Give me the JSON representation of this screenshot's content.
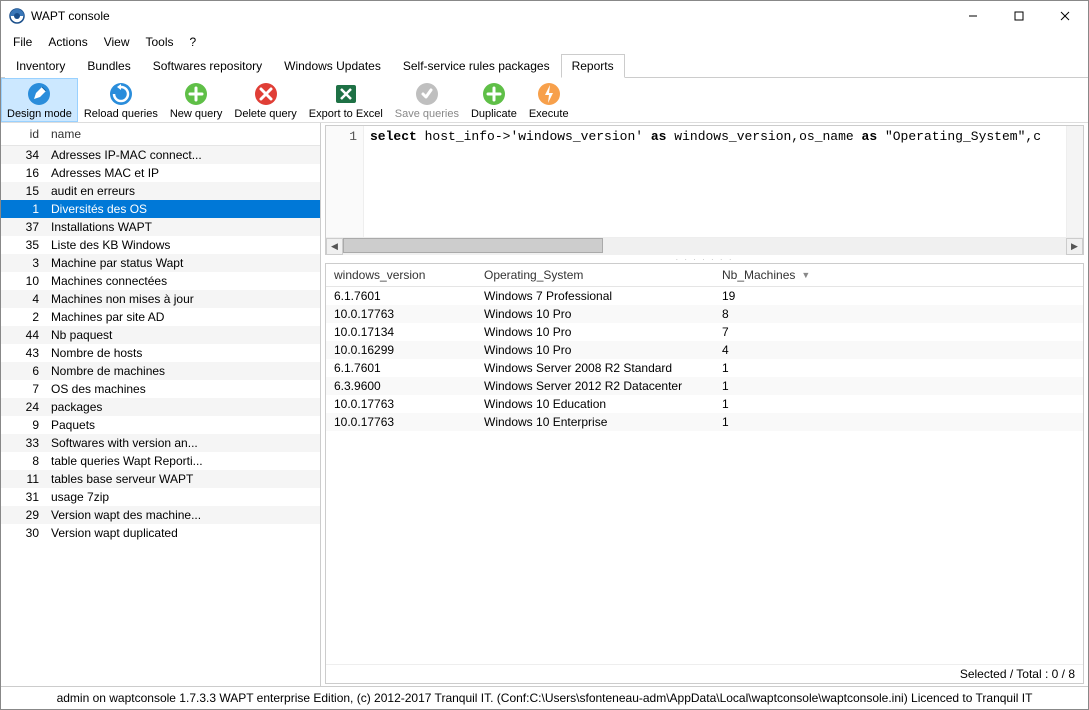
{
  "window": {
    "title": "WAPT console"
  },
  "menu": {
    "items": [
      "File",
      "Actions",
      "View",
      "Tools",
      "?"
    ]
  },
  "tabs": {
    "items": [
      "Inventory",
      "Bundles",
      "Softwares repository",
      "Windows Updates",
      "Self-service rules packages",
      "Reports"
    ],
    "active_index": 5
  },
  "toolbar": {
    "design_mode": "Design mode",
    "reload": "Reload queries",
    "new": "New query",
    "delete": "Delete query",
    "export": "Export to Excel",
    "save": "Save queries",
    "duplicate": "Duplicate",
    "execute": "Execute"
  },
  "queries": {
    "header_id": "id",
    "header_name": "name",
    "selected_id": 1,
    "rows": [
      {
        "id": 34,
        "name": "Adresses IP-MAC connect..."
      },
      {
        "id": 16,
        "name": "Adresses MAC et IP"
      },
      {
        "id": 15,
        "name": "audit en erreurs"
      },
      {
        "id": 1,
        "name": "Diversités des OS"
      },
      {
        "id": 37,
        "name": "Installations WAPT"
      },
      {
        "id": 35,
        "name": "Liste des KB Windows"
      },
      {
        "id": 3,
        "name": "Machine par status Wapt"
      },
      {
        "id": 10,
        "name": "Machines connectées"
      },
      {
        "id": 4,
        "name": "Machines non mises à jour"
      },
      {
        "id": 2,
        "name": "Machines par site AD"
      },
      {
        "id": 44,
        "name": "Nb paquest"
      },
      {
        "id": 43,
        "name": "Nombre de hosts"
      },
      {
        "id": 6,
        "name": "Nombre de machines"
      },
      {
        "id": 7,
        "name": "OS des machines"
      },
      {
        "id": 24,
        "name": "packages"
      },
      {
        "id": 9,
        "name": "Paquets"
      },
      {
        "id": 33,
        "name": "Softwares with version an..."
      },
      {
        "id": 8,
        "name": "table queries Wapt Reporti..."
      },
      {
        "id": 11,
        "name": "tables base serveur WAPT"
      },
      {
        "id": 31,
        "name": "usage 7zip"
      },
      {
        "id": 29,
        "name": "Version wapt des machine..."
      },
      {
        "id": 30,
        "name": "Version wapt duplicated"
      }
    ]
  },
  "sql": {
    "line_no": "1",
    "tokens": {
      "t1": "select",
      "t2": " host_info->",
      "t3": "'windows_version'",
      "t4": " ",
      "t5": "as",
      "t6": " windows_version,os_name ",
      "t7": "as",
      "t8": " ",
      "t9": "\"Operating_System\"",
      "t10": ",c"
    }
  },
  "results": {
    "columns": {
      "c1": "windows_version",
      "c2": "Operating_System",
      "c3": "Nb_Machines"
    },
    "rows": [
      {
        "v": "6.1.7601",
        "os": "Windows 7 Professional",
        "n": "19"
      },
      {
        "v": "10.0.17763",
        "os": "Windows 10 Pro",
        "n": "8"
      },
      {
        "v": "10.0.17134",
        "os": "Windows 10 Pro",
        "n": "7"
      },
      {
        "v": "10.0.16299",
        "os": "Windows 10 Pro",
        "n": "4"
      },
      {
        "v": "6.1.7601",
        "os": "Windows Server 2008 R2 Standard",
        "n": "1"
      },
      {
        "v": "6.3.9600",
        "os": "Windows Server 2012 R2 Datacenter",
        "n": "1"
      },
      {
        "v": "10.0.17763",
        "os": "Windows 10 Education",
        "n": "1"
      },
      {
        "v": "10.0.17763",
        "os": "Windows 10 Enterprise",
        "n": "1"
      }
    ],
    "footer": "Selected / Total : 0 / 8"
  },
  "status": "admin on waptconsole 1.7.3.3 WAPT enterprise Edition, (c) 2012-2017 Tranquil IT. (Conf:C:\\Users\\sfonteneau-adm\\AppData\\Local\\waptconsole\\waptconsole.ini) Licenced to Tranquil IT"
}
